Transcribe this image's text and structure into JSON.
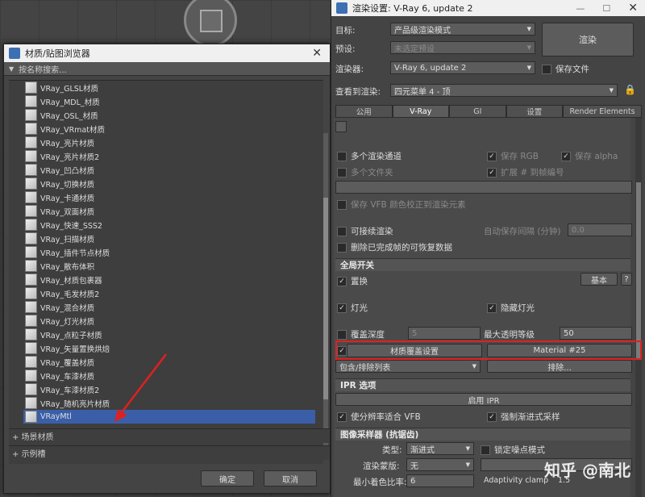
{
  "browser": {
    "title": "材质/贴图浏览器",
    "search_label": "按名称搜索...",
    "items": [
      "VRay_GLSL材质",
      "VRay_MDL_材质",
      "VRay_OSL_材质",
      "VRay_VRmat材质",
      "VRay_亮片材质",
      "VRay_亮片材质2",
      "VRay_凹凸材质",
      "VRay_切换材质",
      "VRay_卡通材质",
      "VRay_双面材质",
      "VRay_快速_SSS2",
      "VRay_扫描材质",
      "VRay_插件节点材质",
      "VRay_散布体积",
      "VRay_材质包裹器",
      "VRay_毛发材质2",
      "VRay_混合材质",
      "VRay_灯光材质",
      "VRay_点粒子材质",
      "VRay_矢量置换烘焙",
      "VRay_覆盖材质",
      "VRay_车漆材质",
      "VRay_车漆材质2",
      "VRay_随机亮片材质",
      "VRayMtl"
    ],
    "selected_item": "VRayMtl",
    "groups": [
      "+ 场景材质",
      "+ 示例槽"
    ],
    "ok_label": "确定",
    "cancel_label": "取消"
  },
  "render": {
    "title": "渲染设置: V-Ray 6, update 2",
    "target_label": "目标:",
    "target_value": "产品级渲染模式",
    "preset_label": "预设:",
    "preset_value": "未选定预设",
    "renderer_label": "渲染器:",
    "renderer_value": "V-Ray 6, update 2",
    "render_button": "渲染",
    "save_file": "保存文件",
    "view_label": "查看到渲染:",
    "view_value": "四元菜单 4 - 顶",
    "tabs": [
      "公用",
      "V-Ray",
      "GI",
      "设置",
      "Render Elements"
    ],
    "active_tab": "V-Ray",
    "multi_channel": "多个渲染通道",
    "save_rgb": "保存 RGB",
    "save_alpha": "保存 alpha",
    "multi_files": "多个文件夹",
    "extend_frames": "扩展 # 到帧编号",
    "save_vfb": "保存 VFB 颜色校正到渲染元素",
    "resumable": "可接续渲染",
    "autosave": "自动保存间隔 (分钟)",
    "autosave_val": "0.0",
    "delete_frames": "删除已完成帧的可恢复数据",
    "global_switches": "全局开关",
    "displacement": "置换",
    "basic": "基本",
    "help": "?",
    "lights": "灯光",
    "hidden_lights": "隐藏灯光",
    "override_depth": "覆盖深度",
    "depth_val": "5",
    "max_transp": "最大透明等级",
    "transp_val": "50",
    "override_mtl": "材质覆盖设置",
    "material_name": "Material #25",
    "include_list": "包含/排除列表",
    "exclude": "排除...",
    "ipr_options": "IPR 选项",
    "start_ipr": "启用 IPR",
    "fit_vfb": "使分辨率适合 VFB",
    "force_prog": "强制渐进式采样",
    "sampler": "图像采样器 (抗锯齿)",
    "type_label": "类型:",
    "type_value": "渐进式",
    "lock_noise": "锁定噪点模式",
    "mask_label": "渲染蒙版:",
    "mask_value": "无",
    "min_shade": "最小着色比率:",
    "min_shade_val": "6",
    "adapt_clamp": "Adaptivity clamp",
    "adapt_val": "1.5"
  },
  "watermark": "知乎 @南北"
}
